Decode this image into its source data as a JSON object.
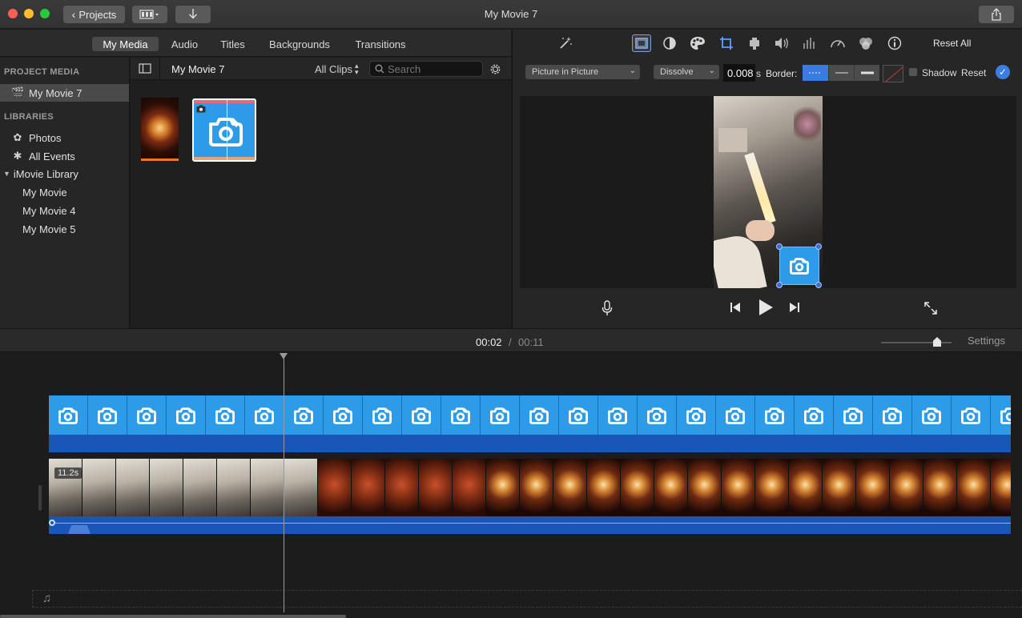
{
  "window": {
    "title": "My Movie 7"
  },
  "toolbar": {
    "projects_label": "Projects"
  },
  "browser_tabs": [
    {
      "label": "My Media",
      "active": true
    },
    {
      "label": "Audio",
      "active": false
    },
    {
      "label": "Titles",
      "active": false
    },
    {
      "label": "Backgrounds",
      "active": false
    },
    {
      "label": "Transitions",
      "active": false
    }
  ],
  "sidebar": {
    "project_media_header": "PROJECT MEDIA",
    "project_item": "My Movie 7",
    "libraries_header": "LIBRARIES",
    "library_items": [
      "Photos",
      "All Events"
    ],
    "imovie_library": "iMovie Library",
    "library_projects": [
      "My Movie",
      "My Movie 4",
      "My Movie 5"
    ]
  },
  "browser": {
    "project_title": "My Movie 7",
    "filter": "All Clips",
    "search_placeholder": "Search"
  },
  "adjustments": {
    "reset_all": "Reset All",
    "overlay_style": "Picture in Picture",
    "transition": "Dissolve",
    "duration": "0.008",
    "duration_unit": "s",
    "border_label": "Border:",
    "shadow_label": "Shadow",
    "reset_label": "Reset"
  },
  "timeline": {
    "current_time": "00:02",
    "separator": "/",
    "total_time": "00:11",
    "settings_label": "Settings",
    "clip_duration": "11.2s"
  },
  "colors": {
    "accent": "#3b7be0",
    "clip_blue": "#2e9be8",
    "audio_blue": "#1a55b8"
  },
  "icons": {
    "enhance": "magic-wand-icon",
    "crop_overlay": "overlay-settings-icon",
    "color_balance": "color-balance-icon",
    "color_correction": "palette-icon",
    "crop": "crop-icon",
    "stabilization": "camera-stabilization-icon",
    "volume": "volume-icon",
    "equalizer": "equalizer-icon",
    "speed": "speedometer-icon",
    "filters": "clip-filter-icon",
    "info": "info-icon"
  }
}
